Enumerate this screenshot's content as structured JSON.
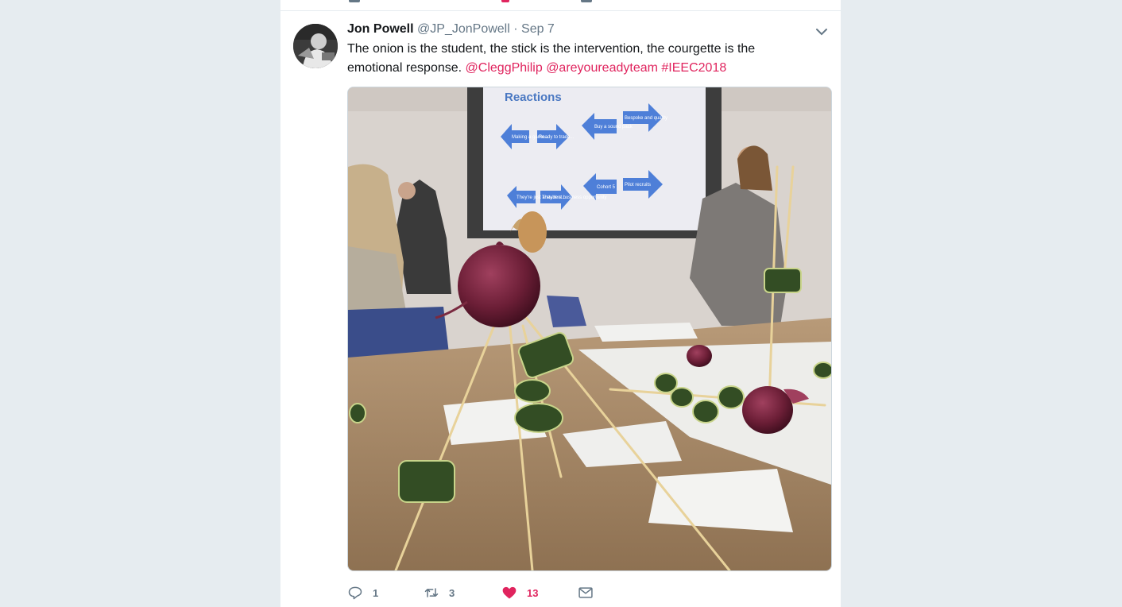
{
  "tweet": {
    "author_name": "Jon Powell",
    "author_handle": "@JP_JonPowell",
    "separator": "·",
    "timestamp": "Sep 7",
    "text_plain": "The onion is the student, the stick is the intervention, the courgette is the emotional response.",
    "mentions": [
      "@CleggPhilip",
      "@areyoureadyteam"
    ],
    "hashtag": "#IEEC2018"
  },
  "slide": {
    "title": "Reactions",
    "arrows": [
      "Making a game...",
      "Ready to trade...",
      "Buy a sound pack",
      "Bespoke and quality",
      "They're just a student...",
      "They're a business opportunity",
      "Cohort 5",
      "Pilot recruits"
    ]
  },
  "actions": {
    "reply_count": "1",
    "retweet_count": "3",
    "like_count": "13"
  },
  "colors": {
    "accent": "#e0245e",
    "muted": "#657786",
    "link": "#e0245e",
    "background": "#e6ecf0"
  },
  "icons": {
    "caret": "chevron-down-icon",
    "reply": "reply-icon",
    "retweet": "retweet-icon",
    "like": "heart-icon",
    "dm": "envelope-icon"
  }
}
